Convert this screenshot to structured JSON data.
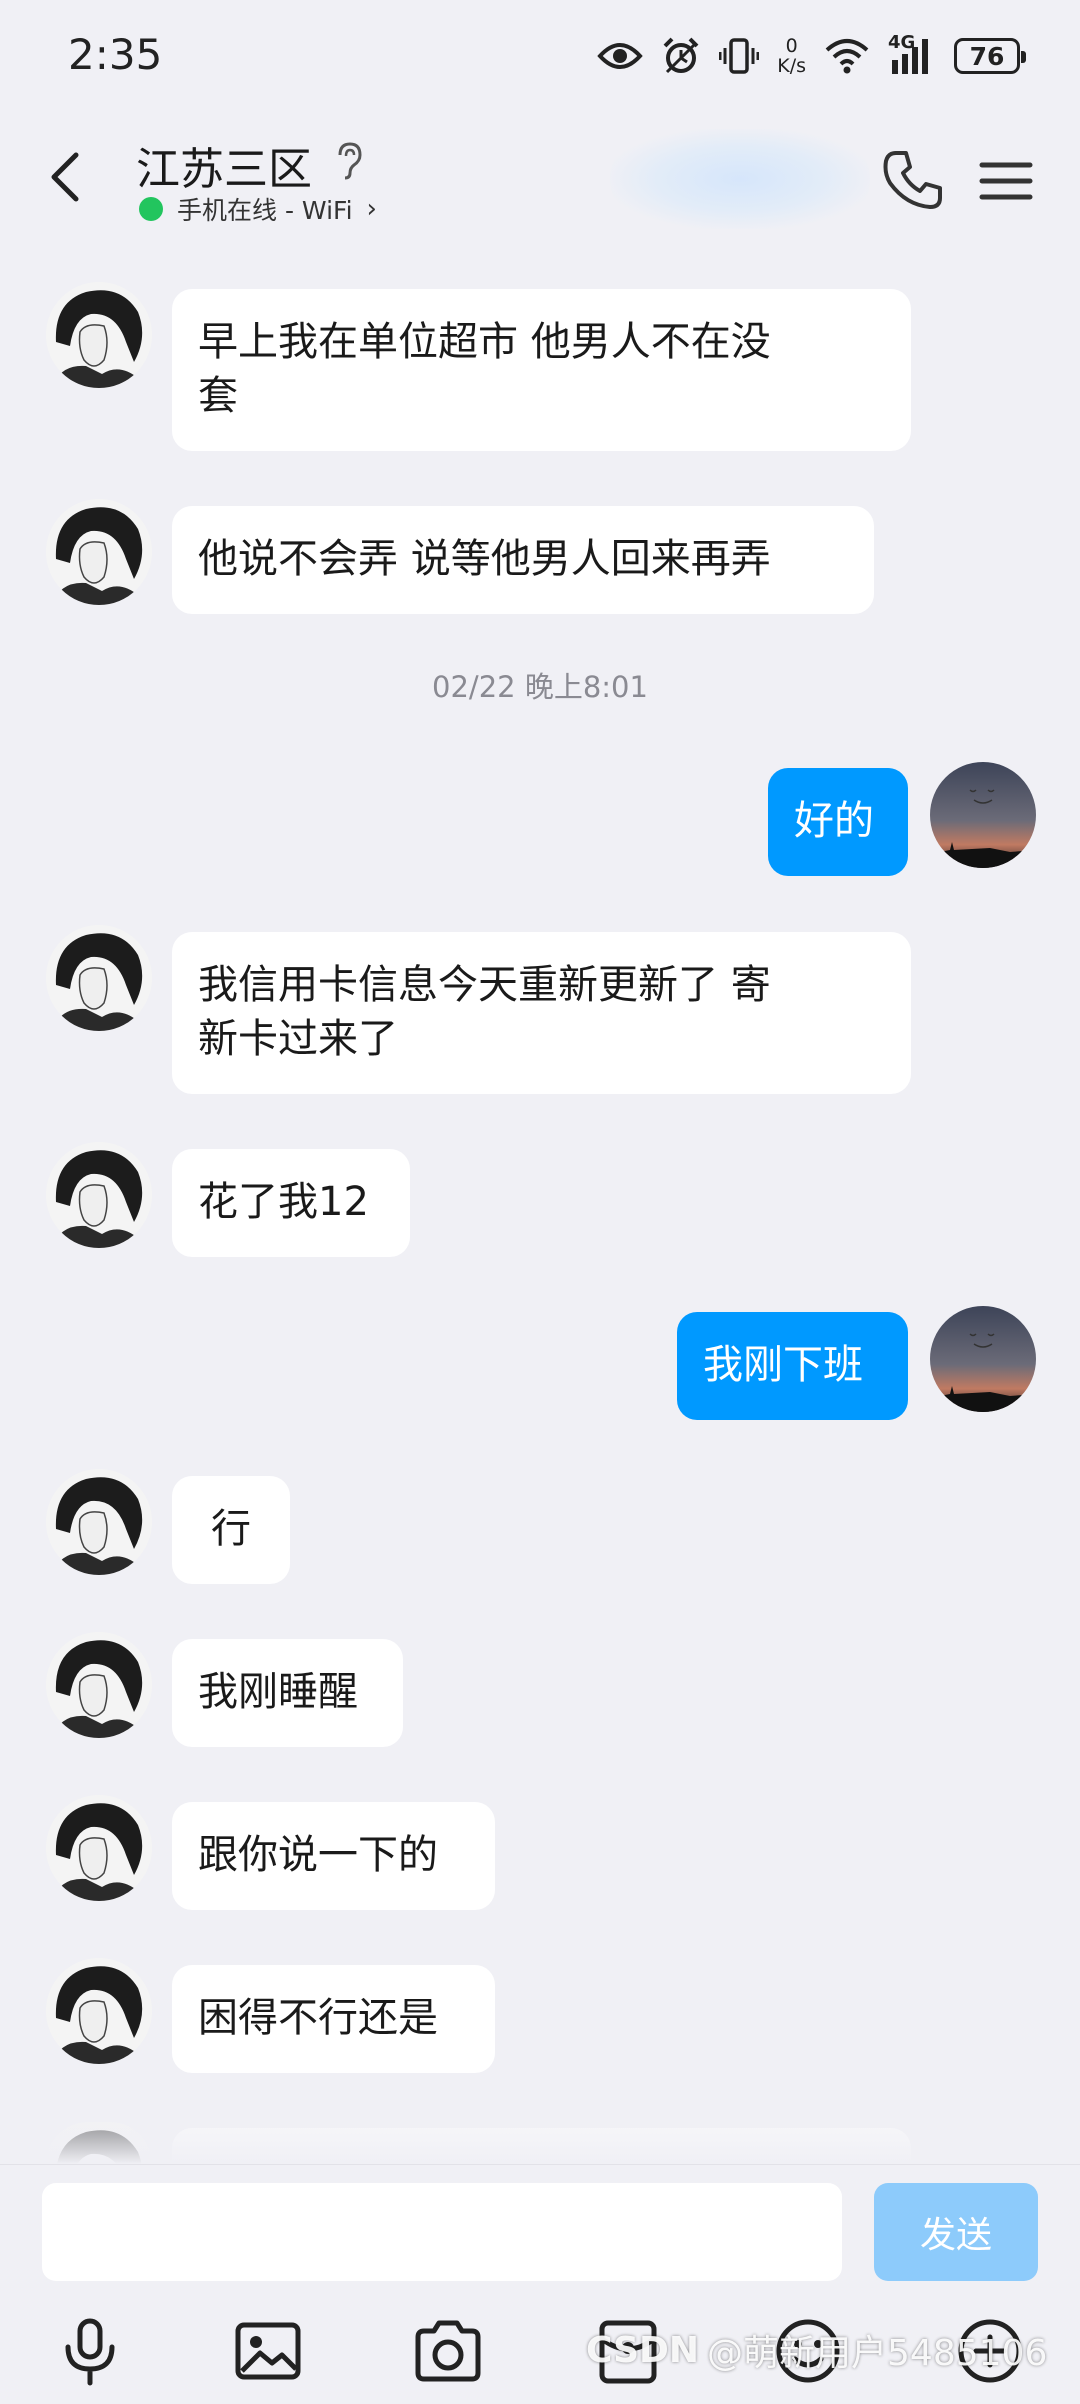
{
  "status_bar": {
    "time": "2:35",
    "net_speed_value": "0",
    "net_speed_unit": "K/s",
    "network_type": "4G",
    "battery": "76",
    "icons": [
      "eye-icon",
      "alarm-icon",
      "vibrate-icon",
      "wifi-icon",
      "signal-icon",
      "battery-icon"
    ]
  },
  "header": {
    "title": "江苏三区",
    "status": "手机在线 - WiFi",
    "online_color": "#22c55e"
  },
  "messages": [
    {
      "direction": "in",
      "lines": [
        "早上我在单位超市 他男人不在没",
        "套"
      ]
    },
    {
      "direction": "in",
      "lines": [
        "他说不会弄 说等他男人回来再弄"
      ]
    },
    {
      "direction": "in",
      "lines": [
        "我信用卡信息今天重新更新了 寄",
        "新卡过来了"
      ]
    },
    {
      "direction": "in",
      "lines": [
        "花了我12"
      ]
    },
    {
      "direction": "in",
      "lines": [
        "行"
      ]
    },
    {
      "direction": "in",
      "lines": [
        "我刚睡醒"
      ]
    },
    {
      "direction": "in",
      "lines": [
        "跟你说一下的"
      ]
    },
    {
      "direction": "in",
      "lines": [
        "困得不行还是"
      ]
    }
  ],
  "outgoing": [
    {
      "text": "好的"
    },
    {
      "text": "我刚下班"
    }
  ],
  "timestamp": "02/22 晚上8:01",
  "input": {
    "placeholder": "",
    "value": "",
    "send_label": "发送"
  },
  "toolbar": [
    "microphone-icon",
    "image-icon",
    "camera-icon",
    "red-packet-icon",
    "emoji-icon",
    "plus-icon"
  ],
  "watermark": {
    "logo": "CSDN",
    "text": "@萌新用户5485106"
  },
  "colors": {
    "background": "#f0f0f5",
    "outgoing_bubble": "#0099ff",
    "incoming_bubble": "#ffffff",
    "send_button": "#8dcbfb"
  }
}
